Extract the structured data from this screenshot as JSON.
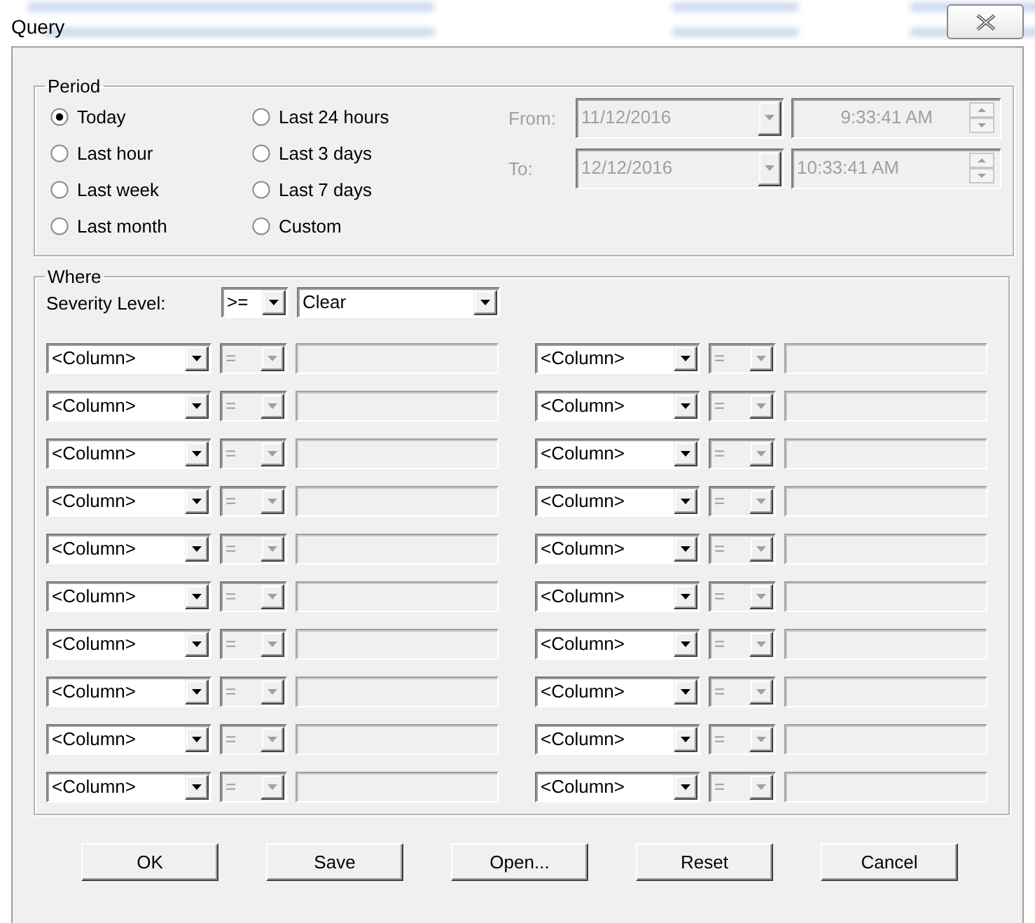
{
  "window": {
    "title": "Query"
  },
  "period": {
    "legend": "Period",
    "options": [
      {
        "label": "Today",
        "selected": true
      },
      {
        "label": "Last hour",
        "selected": false
      },
      {
        "label": "Last week",
        "selected": false
      },
      {
        "label": "Last month",
        "selected": false
      },
      {
        "label": "Last 24 hours",
        "selected": false
      },
      {
        "label": "Last 3 days",
        "selected": false
      },
      {
        "label": "Last 7 days",
        "selected": false
      },
      {
        "label": "Custom",
        "selected": false
      }
    ],
    "range": [
      {
        "label": "From:",
        "date": "11/12/2016",
        "time": "9:33:41 AM",
        "disabled": true
      },
      {
        "label": "To:",
        "date": "12/12/2016",
        "time": "10:33:41 AM",
        "disabled": true
      }
    ]
  },
  "where": {
    "legend": "Where",
    "severity": {
      "label": "Severity Level:",
      "operator": ">=",
      "value": "Clear"
    },
    "conditions": [
      {
        "column": "<Column>",
        "operator": "=",
        "disabled": true
      },
      {
        "column": "<Column>",
        "operator": "=",
        "disabled": true
      },
      {
        "column": "<Column>",
        "operator": "=",
        "disabled": true
      },
      {
        "column": "<Column>",
        "operator": "=",
        "disabled": true
      },
      {
        "column": "<Column>",
        "operator": "=",
        "disabled": true
      },
      {
        "column": "<Column>",
        "operator": "=",
        "disabled": true
      },
      {
        "column": "<Column>",
        "operator": "=",
        "disabled": true
      },
      {
        "column": "<Column>",
        "operator": "=",
        "disabled": true
      },
      {
        "column": "<Column>",
        "operator": "=",
        "disabled": true
      },
      {
        "column": "<Column>",
        "operator": "=",
        "disabled": true
      },
      {
        "column": "<Column>",
        "operator": "=",
        "disabled": true
      },
      {
        "column": "<Column>",
        "operator": "=",
        "disabled": true
      },
      {
        "column": "<Column>",
        "operator": "=",
        "disabled": true
      },
      {
        "column": "<Column>",
        "operator": "=",
        "disabled": true
      },
      {
        "column": "<Column>",
        "operator": "=",
        "disabled": true
      },
      {
        "column": "<Column>",
        "operator": "=",
        "disabled": true
      },
      {
        "column": "<Column>",
        "operator": "=",
        "disabled": true
      },
      {
        "column": "<Column>",
        "operator": "=",
        "disabled": true
      },
      {
        "column": "<Column>",
        "operator": "=",
        "disabled": true
      },
      {
        "column": "<Column>",
        "operator": "=",
        "disabled": true
      }
    ]
  },
  "buttons": [
    {
      "label": "OK"
    },
    {
      "label": "Save"
    },
    {
      "label": "Open..."
    },
    {
      "label": "Reset"
    },
    {
      "label": "Cancel"
    }
  ]
}
